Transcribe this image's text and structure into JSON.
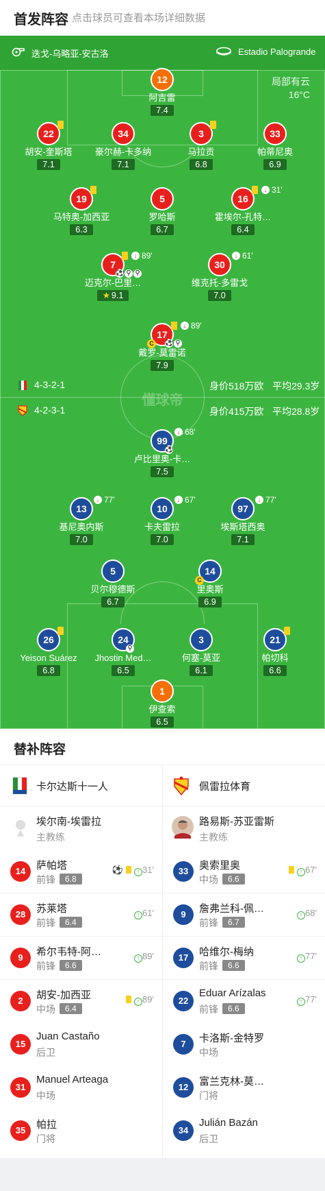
{
  "header": {
    "title": "首发阵容",
    "subtitle": "点击球员可查看本场详细数据"
  },
  "pitch_info": {
    "coach_icon": "whistle-icon",
    "coach": "迭戈-乌略亚-安古洛",
    "stadium_icon": "stadium-icon",
    "stadium": "Estadio Palogrande"
  },
  "weather": {
    "condition": "局部有云",
    "temp": "16°C"
  },
  "watermark": "懂球帝",
  "formations": {
    "home": {
      "formation": "4-3-2-1",
      "value": "身价518万欧",
      "age": "平均29.3岁"
    },
    "away": {
      "formation": "4-2-3-1",
      "value": "身价415万欧",
      "age": "平均28.8岁"
    }
  },
  "home_players": [
    {
      "num": "12",
      "name": "阿吉雷",
      "rating": "7.4"
    },
    {
      "num": "22",
      "name": "胡安-奎斯塔",
      "rating": "7.1"
    },
    {
      "num": "34",
      "name": "豪尔赫-卡多纳",
      "rating": "7.1"
    },
    {
      "num": "3",
      "name": "马拉贡",
      "rating": "6.8"
    },
    {
      "num": "33",
      "name": "帕蒂尼奥",
      "rating": "6.9"
    },
    {
      "num": "19",
      "name": "马特奥-加西亚",
      "rating": "6.3"
    },
    {
      "num": "5",
      "name": "罗哈斯",
      "rating": "6.7"
    },
    {
      "num": "16",
      "name": "霍埃尔-孔特…",
      "rating": "6.4",
      "minute": "31'"
    },
    {
      "num": "7",
      "name": "迈克尔-巴里…",
      "rating": "9.1",
      "minute": "89'"
    },
    {
      "num": "30",
      "name": "维克托-多雷戈",
      "rating": "7.0",
      "minute": "61'"
    },
    {
      "num": "17",
      "name": "戴罗-莫雷诺",
      "rating": "7.9",
      "minute": "89'"
    }
  ],
  "away_players": [
    {
      "num": "99",
      "name": "卢比里奥-卡…",
      "rating": "7.5",
      "minute": "68'"
    },
    {
      "num": "13",
      "name": "基尼奥内斯",
      "rating": "7.0",
      "minute": "77'"
    },
    {
      "num": "10",
      "name": "卡夫雷拉",
      "rating": "7.0",
      "minute": "67'"
    },
    {
      "num": "97",
      "name": "埃斯塔西奥",
      "rating": "7.1",
      "minute": "77'"
    },
    {
      "num": "5",
      "name": "贝尔穆德斯",
      "rating": "6.7"
    },
    {
      "num": "14",
      "name": "里奥斯",
      "rating": "6.9"
    },
    {
      "num": "26",
      "name": "Yeison Suárez",
      "rating": "6.8"
    },
    {
      "num": "24",
      "name": "Jhostin Med…",
      "rating": "6.5"
    },
    {
      "num": "3",
      "name": "何塞-莫亚",
      "rating": "6.1"
    },
    {
      "num": "21",
      "name": "帕切科",
      "rating": "6.6"
    },
    {
      "num": "1",
      "name": "伊查索",
      "rating": "6.5"
    }
  ],
  "subs": {
    "title": "替补阵容",
    "home_team": "卡尔达斯十一人",
    "away_team": "佩雷拉体育",
    "home_coach": {
      "name": "埃尔南-埃雷拉",
      "role": "主教练"
    },
    "away_coach": {
      "name": "路易斯-苏亚雷斯",
      "role": "主教练"
    },
    "home": [
      {
        "num": "14",
        "name": "萨帕塔",
        "pos": "前锋",
        "rating": "6.8",
        "minute": "31'"
      },
      {
        "num": "28",
        "name": "苏莱塔",
        "pos": "前锋",
        "rating": "6.4",
        "minute": "61'"
      },
      {
        "num": "9",
        "name": "希尔韦特-阿…",
        "pos": "前锋",
        "rating": "6.6",
        "minute": "89'"
      },
      {
        "num": "2",
        "name": "胡安-加西亚",
        "pos": "中场",
        "rating": "6.4",
        "minute": "89'"
      },
      {
        "num": "15",
        "name": "Juan Castaño",
        "pos": "后卫"
      },
      {
        "num": "31",
        "name": "Manuel Arteaga",
        "pos": "中场"
      },
      {
        "num": "35",
        "name": "帕拉",
        "pos": "门将"
      }
    ],
    "away": [
      {
        "num": "33",
        "name": "奥索里奥",
        "pos": "中场",
        "rating": "6.6",
        "minute": "67'"
      },
      {
        "num": "9",
        "name": "詹弗兰科-佩…",
        "pos": "前锋",
        "rating": "6.7",
        "minute": "68'"
      },
      {
        "num": "17",
        "name": "哈维尔-梅纳",
        "pos": "前锋",
        "rating": "6.6",
        "minute": "77'"
      },
      {
        "num": "22",
        "name": "Eduar Arízalas",
        "pos": "前锋",
        "rating": "6.6",
        "minute": "77'"
      },
      {
        "num": "7",
        "name": "卡洛斯-金特罗",
        "pos": "中场"
      },
      {
        "num": "12",
        "name": "富兰克林-莫…",
        "pos": "门将"
      },
      {
        "num": "34",
        "name": "Julián Bazán",
        "pos": "后卫"
      }
    ]
  },
  "colors": {
    "home": "#e8201d",
    "away": "#1e4d9c",
    "gk": "#f46f06",
    "pitch": "#3cb540"
  }
}
